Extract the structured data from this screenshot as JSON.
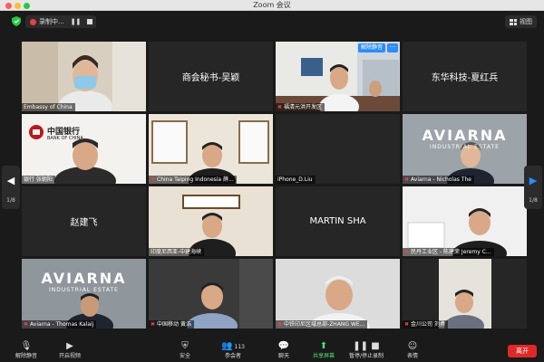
{
  "window": {
    "title": "Zoom 会议"
  },
  "topbar": {
    "recording_label": "录制中...",
    "view_label": "视图"
  },
  "tiles": [
    {
      "name": "Embassy of China",
      "center": "",
      "muted": false
    },
    {
      "name": "",
      "center": "商会秘书-吴颖",
      "muted": true
    },
    {
      "name": "福清元洪开发区",
      "center": "",
      "muted": true,
      "unmute_label": "解除静音"
    },
    {
      "name": "",
      "center": "东华科技-夏红兵",
      "muted": false
    },
    {
      "name": "银行 张朝阳",
      "center": "",
      "muted": false
    },
    {
      "name": "China Taiping Indonesia 薛...",
      "center": "",
      "muted": true
    },
    {
      "name": "iPhone_D.Liu",
      "center": "",
      "muted": false
    },
    {
      "name": "Aviarna - Nicholas The",
      "center": "",
      "muted": true
    },
    {
      "name": "",
      "center": "赵建飞",
      "muted": false
    },
    {
      "name": "印度尼西亚-中建海峡",
      "center": "",
      "muted": false
    },
    {
      "name": "",
      "center": "MARTIN SHA",
      "muted": true
    },
    {
      "name": "民丹工业区 - 陈建荣 Jeremy C...",
      "center": "",
      "muted": true
    },
    {
      "name": "Aviarna - Thomas Kalaij",
      "center": "",
      "muted": true
    },
    {
      "name": "中国移动 黄浩",
      "center": "",
      "muted": true
    },
    {
      "name": "中铁印尼区域总部-ZHANG WE...",
      "center": "",
      "muted": true
    },
    {
      "name": "金川公司 刘勇",
      "center": "",
      "muted": true
    }
  ],
  "tile_text": {
    "bank_name": "中国银行",
    "bank_en": "BANK OF CHINA",
    "aviarna_top": "AVIARNA",
    "aviarna_sub": "INDUSTRIAL ESTATE"
  },
  "pagination": {
    "left": "1/8",
    "right": "1/8"
  },
  "toolbar": {
    "unmute": "解除静音",
    "start_video": "开启视频",
    "security": "安全",
    "participants": "参会者",
    "participants_count": "113",
    "chat": "聊天",
    "share": "共享屏幕",
    "pause_record": "暂停/停止录制",
    "reactions": "表情",
    "leave": "离开"
  },
  "colors": {
    "accent": "#2d8cff",
    "share_green": "#4ee07b",
    "leave_red": "#e02828",
    "active_border": "#c6e23f",
    "mute_red": "#e8414c"
  }
}
